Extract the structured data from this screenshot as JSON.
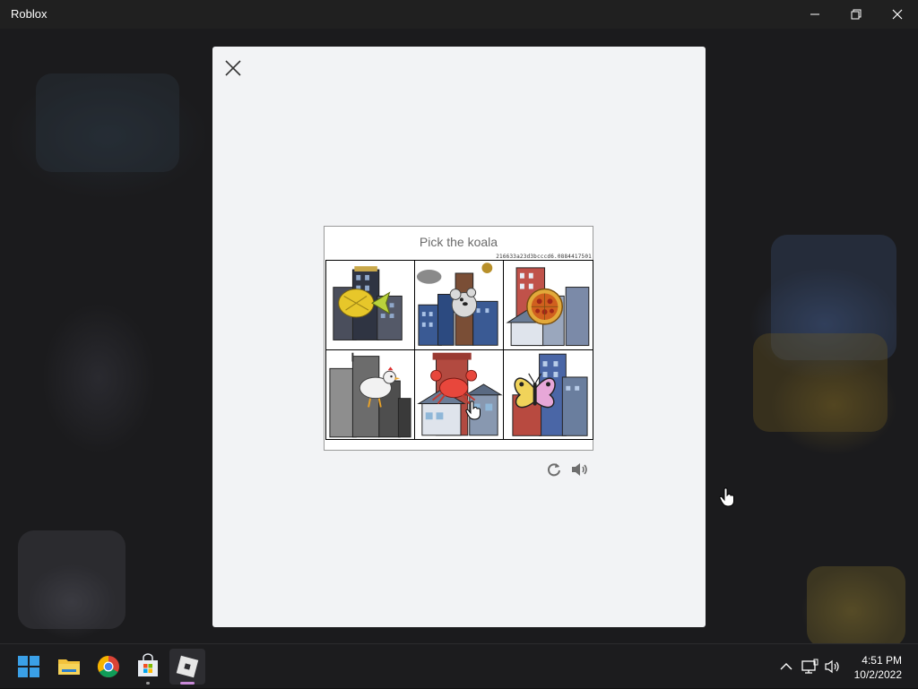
{
  "window": {
    "title": "Roblox"
  },
  "window_controls": {
    "minimize": "—",
    "maximize": "❐",
    "close": "✕"
  },
  "captcha": {
    "prompt": "Pick the koala",
    "token": "216633a23d3bcccd6.0884417501",
    "tiles": [
      {
        "subject": "pineapple-fish"
      },
      {
        "subject": "koala-on-tower"
      },
      {
        "subject": "pizza"
      },
      {
        "subject": "chicken"
      },
      {
        "subject": "crab"
      },
      {
        "subject": "butterfly"
      }
    ],
    "reload_icon": "refresh-icon",
    "audio_icon": "speaker-icon"
  },
  "taskbar": {
    "apps": [
      "start-icon",
      "file-explorer-icon",
      "chrome-icon",
      "microsoft-store-icon",
      "roblox-icon"
    ],
    "active_app": "roblox-icon",
    "tray_icons": [
      "chevron-up-icon",
      "network-icon",
      "volume-icon"
    ],
    "time": "4:51 PM",
    "date": "10/2/2022"
  },
  "colors": {
    "modal": "#f2f3f5",
    "taskbar": "#1c1c1e",
    "titlebar": "#202020"
  }
}
